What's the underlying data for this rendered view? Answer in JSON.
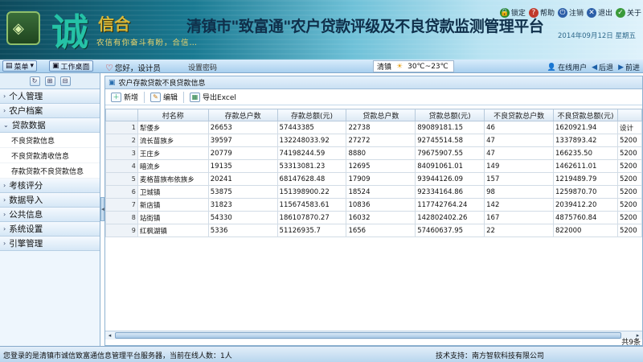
{
  "header": {
    "brand_big": "诚",
    "brand_name": "信合",
    "brand_slogan": "农信有你奋斗有盼，合信…",
    "system_title": "清镇市\"致富通\"农户贷款评级及不良贷款监测管理平台",
    "date": "2014年09月12日 星期五",
    "top_links": [
      {
        "label": "锁定",
        "icon": "lock-icon",
        "color": "#2a8a2a"
      },
      {
        "label": "帮助",
        "icon": "help-icon",
        "color": "#c0392b"
      },
      {
        "label": "注销",
        "icon": "logout-icon",
        "color": "#2c5fa8"
      },
      {
        "label": "退出",
        "icon": "exit-icon",
        "color": "#2c5fa8"
      },
      {
        "label": "关于",
        "icon": "about-icon",
        "color": "#3a9a3a"
      }
    ]
  },
  "toolbar": {
    "menu_label": "菜单",
    "desktop_label": "工作桌面",
    "greeting": "您好，设计员",
    "change_password": "设置密码",
    "weather_city": "清镇",
    "weather_temp": "30℃~23℃",
    "online_users": "在线用户",
    "back": "后退",
    "forward": "前进"
  },
  "sidebar": {
    "tools": [
      "↻",
      "⊞",
      "⊟"
    ],
    "groups": [
      {
        "label": "个人管理",
        "arrow": "›",
        "expanded": false
      },
      {
        "label": "农户档案",
        "arrow": "›",
        "expanded": false
      },
      {
        "label": "贷款数据",
        "arrow": "⌄",
        "expanded": true,
        "items": [
          "不良贷款信息",
          "不良贷款清收信息",
          "存款贷款不良贷款信息"
        ]
      },
      {
        "label": "考核评分",
        "arrow": "›",
        "expanded": false
      },
      {
        "label": "数据导入",
        "arrow": "›",
        "expanded": false
      },
      {
        "label": "公共信息",
        "arrow": "›",
        "expanded": false
      },
      {
        "label": "系统设置",
        "arrow": "›",
        "expanded": false
      },
      {
        "label": "引擎管理",
        "arrow": "›",
        "expanded": false
      }
    ]
  },
  "panel": {
    "title": "农户存款贷款不良贷款信息",
    "buttons": {
      "add": "新增",
      "edit": "编辑",
      "export": "导出Excel"
    },
    "columns": [
      "村名称",
      "存款总户数",
      "存款总额(元)",
      "贷款总户数",
      "贷款总额(元)",
      "不良贷款总户数",
      "不良贷款总额(元)",
      ""
    ],
    "rows": [
      [
        "1",
        "犁倭乡",
        "26653",
        "57443385",
        "22738",
        "89089181.15",
        "46",
        "1620921.94",
        "设计"
      ],
      [
        "2",
        "流长苗族乡",
        "39597",
        "132248033.92",
        "27272",
        "92745514.58",
        "47",
        "1337893.42",
        "5200"
      ],
      [
        "3",
        "王庄乡",
        "20779",
        "74198244.59",
        "8880",
        "79675907.55",
        "47",
        "166235.50",
        "5200"
      ],
      [
        "4",
        "暗流乡",
        "19135",
        "53313081.23",
        "12695",
        "84091061.01",
        "149",
        "1462611.01",
        "5200"
      ],
      [
        "5",
        "麦格苗族布依族乡",
        "20241",
        "68147628.48",
        "17909",
        "93944126.09",
        "157",
        "1219489.79",
        "5200"
      ],
      [
        "6",
        "卫城镇",
        "53875",
        "151398900.22",
        "18524",
        "92334164.86",
        "98",
        "1259870.70",
        "5200"
      ],
      [
        "7",
        "新店镇",
        "31823",
        "115674583.61",
        "10836",
        "117742764.24",
        "142",
        "2039412.20",
        "5200"
      ],
      [
        "8",
        "站街镇",
        "54330",
        "186107870.27",
        "16032",
        "142802402.26",
        "167",
        "4875760.84",
        "5200"
      ],
      [
        "9",
        "红枫湖镇",
        "5336",
        "51126935.7",
        "1656",
        "57460637.95",
        "22",
        "822000",
        "5200"
      ]
    ],
    "record_count": "共9条"
  },
  "footer": {
    "left": "您登录的是清镇市诚信致富通信息管理平台服务器，当前在线人数：1人",
    "right": "技术支持：南方智软科技有限公司"
  }
}
